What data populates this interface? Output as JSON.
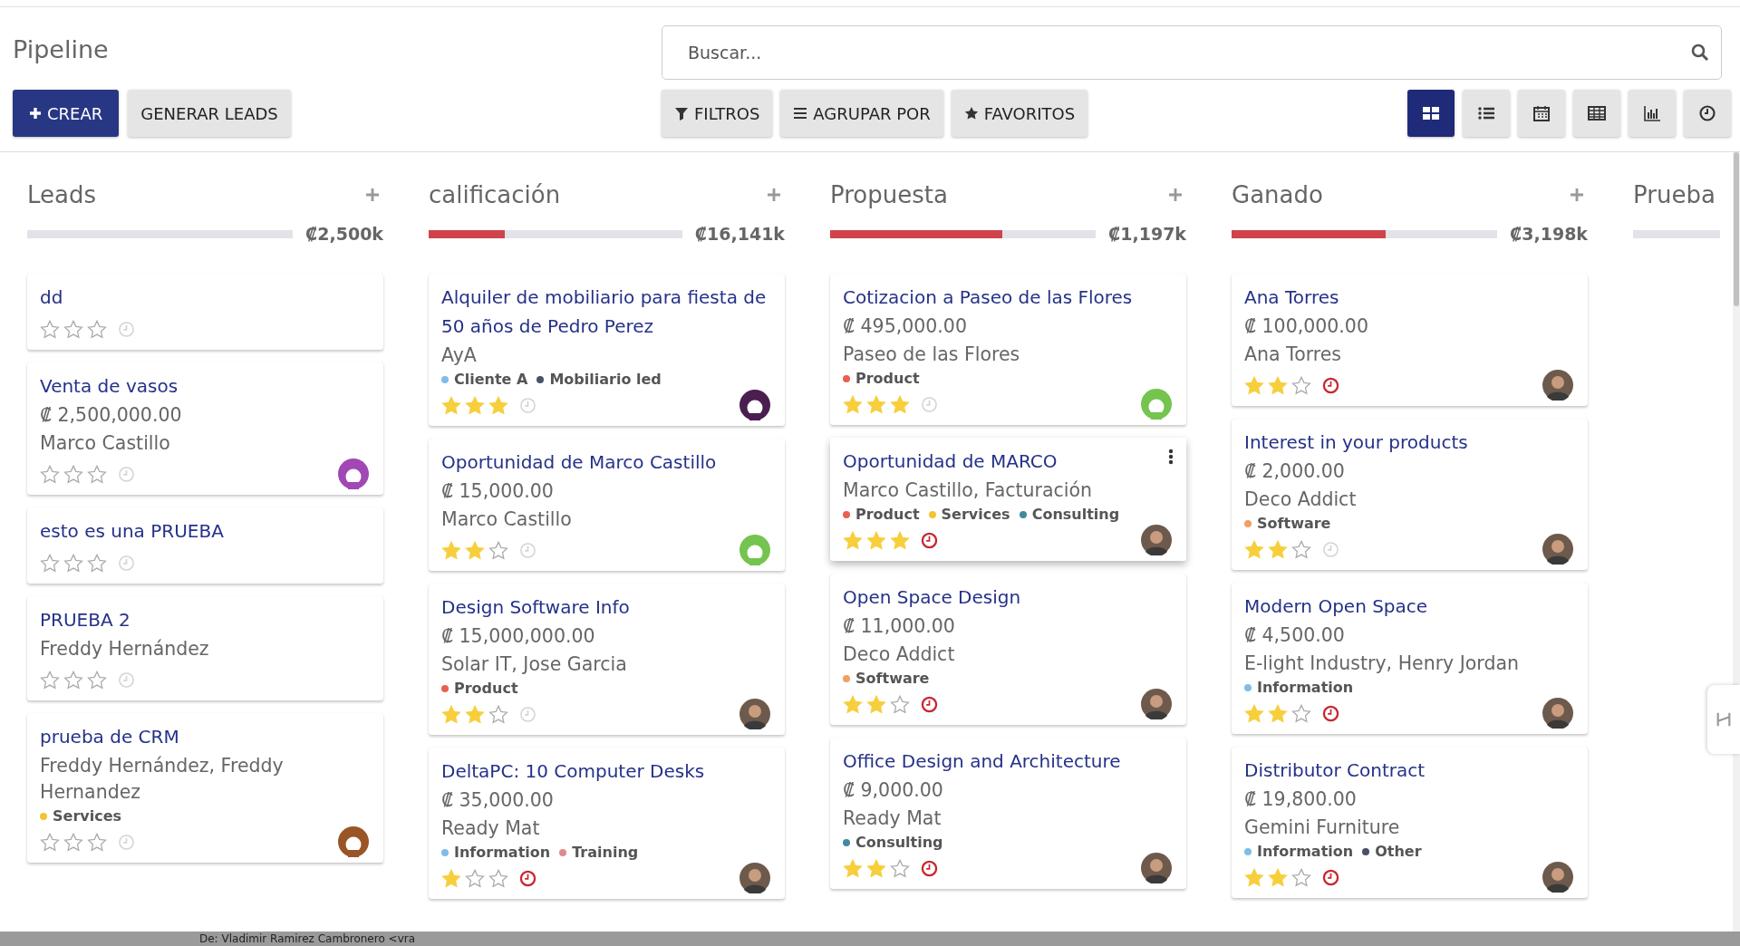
{
  "title": "Pipeline",
  "search": {
    "placeholder": "Buscar..."
  },
  "buttons": [
    {
      "label": "CREAR",
      "kind": "primary"
    },
    {
      "label": "GENERAR LEADS",
      "kind": "secondary"
    }
  ],
  "filters": [
    {
      "label": "FILTROS",
      "kind": "filter"
    },
    {
      "label": "AGRUPAR POR",
      "kind": "group"
    },
    {
      "label": "FAVORITOS",
      "kind": "star"
    }
  ],
  "views": [
    {
      "kind": "kanban",
      "selected": true
    },
    {
      "kind": "list",
      "selected": false
    },
    {
      "kind": "calendar",
      "selected": false
    },
    {
      "kind": "pivot",
      "selected": false
    },
    {
      "kind": "graph",
      "selected": false
    },
    {
      "kind": "activity",
      "selected": false
    }
  ],
  "columns": [
    {
      "name": "Leads",
      "total": "₡2,500k",
      "level": 0,
      "cards": [
        {
          "title": "dd",
          "stars": 0,
          "activity_overdue": false
        },
        {
          "title": "Venta de vasos",
          "amount": "₡ 2,500,000.00",
          "customer": "Marco Castillo",
          "stars": 0,
          "activity_overdue": false,
          "avatar": {
            "kind": "placeholder",
            "color": "#a148b4"
          }
        },
        {
          "title": "esto es una PRUEBA",
          "stars": 0,
          "activity_overdue": false
        },
        {
          "title": "PRUEBA 2",
          "customer": "Freddy Hernández",
          "stars": 0,
          "activity_overdue": false
        },
        {
          "title": "prueba de CRM",
          "customer": "Freddy Hernández, Freddy Hernandez",
          "tags": [
            {
              "name": "Services",
              "color": "#f4c430"
            }
          ],
          "stars": 0,
          "activity_overdue": false,
          "avatar": {
            "kind": "placeholder",
            "color": "#9a5526"
          }
        }
      ]
    },
    {
      "name": "calificación",
      "total": "₡16,141k",
      "level": 0.3,
      "cards": [
        {
          "title": "Alquiler de mobiliario para fiesta de 50 años de Pedro Perez",
          "customer": "AyA",
          "tags": [
            {
              "name": "Cliente A",
              "color": "#7fbde8"
            },
            {
              "name": "Mobiliario led",
              "color": "#4a5068"
            }
          ],
          "stars": 3,
          "activity_overdue": false,
          "avatar": {
            "kind": "placeholder",
            "color": "#4a1f4f"
          }
        },
        {
          "title": "Oportunidad de Marco Castillo",
          "amount": "₡ 15,000.00",
          "customer": "Marco Castillo",
          "stars": 2,
          "activity_overdue": false,
          "avatar": {
            "kind": "placeholder",
            "color": "#74c44f"
          }
        },
        {
          "title": "Design Software Info",
          "amount": "₡ 15,000,000.00",
          "customer": "Solar IT, Jose Garcia",
          "tags": [
            {
              "name": "Product",
              "color": "#e8604f"
            }
          ],
          "stars": 2,
          "activity_overdue": false,
          "avatar": {
            "kind": "photo"
          }
        },
        {
          "title": "DeltaPC: 10 Computer Desks",
          "amount": "₡ 35,000.00",
          "customer": "Ready Mat",
          "tags": [
            {
              "name": "Information",
              "color": "#7fbde8"
            },
            {
              "name": "Training",
              "color": "#e08a8a"
            }
          ],
          "stars": 1,
          "activity_overdue": true,
          "avatar": {
            "kind": "photo"
          }
        }
      ]
    },
    {
      "name": "Propuesta",
      "total": "₡1,197k",
      "level": 0.65,
      "cards": [
        {
          "title": "Cotizacion a Paseo de las Flores",
          "amount": "₡ 495,000.00",
          "customer": "Paseo de las Flores",
          "tags": [
            {
              "name": "Product",
              "color": "#e8604f"
            }
          ],
          "stars": 3,
          "activity_overdue": false,
          "avatar": {
            "kind": "placeholder",
            "color": "#74c44f"
          }
        },
        {
          "title": "Oportunidad de MARCO",
          "customer": "Marco Castillo, Facturación",
          "tags": [
            {
              "name": "Product",
              "color": "#e8604f"
            },
            {
              "name": "Services",
              "color": "#f4c430"
            },
            {
              "name": "Consulting",
              "color": "#3f8a9e"
            }
          ],
          "stars": 3,
          "activity_overdue": true,
          "avatar": {
            "kind": "photo"
          },
          "hovered": true
        },
        {
          "title": "Open Space Design",
          "amount": "₡ 11,000.00",
          "customer": "Deco Addict",
          "tags": [
            {
              "name": "Software",
              "color": "#f0a064"
            }
          ],
          "stars": 2,
          "activity_overdue": true,
          "avatar": {
            "kind": "photo"
          }
        },
        {
          "title": "Office Design and Architecture",
          "amount": "₡ 9,000.00",
          "customer": "Ready Mat",
          "tags": [
            {
              "name": "Consulting",
              "color": "#3f8a9e"
            }
          ],
          "stars": 2,
          "activity_overdue": true,
          "avatar": {
            "kind": "photo"
          }
        }
      ]
    },
    {
      "name": "Ganado",
      "total": "₡3,198k",
      "level": 0.58,
      "cards": [
        {
          "title": "Ana Torres",
          "amount": "₡ 100,000.00",
          "customer": "Ana Torres",
          "stars": 2,
          "activity_overdue": true,
          "avatar": {
            "kind": "photo"
          }
        },
        {
          "title": "Interest in your products",
          "amount": "₡ 2,000.00",
          "customer": "Deco Addict",
          "tags": [
            {
              "name": "Software",
              "color": "#f0a064"
            }
          ],
          "stars": 2,
          "activity_overdue": false,
          "avatar": {
            "kind": "photo"
          }
        },
        {
          "title": "Modern Open Space",
          "amount": "₡ 4,500.00",
          "customer": "E-light Industry, Henry Jordan",
          "tags": [
            {
              "name": "Information",
              "color": "#7fbde8"
            }
          ],
          "stars": 2,
          "activity_overdue": true,
          "avatar": {
            "kind": "photo"
          }
        },
        {
          "title": "Distributor Contract",
          "amount": "₡ 19,800.00",
          "customer": "Gemini Furniture",
          "tags": [
            {
              "name": "Information",
              "color": "#7fbde8"
            },
            {
              "name": "Other",
              "color": "#4a5068"
            }
          ],
          "stars": 2,
          "activity_overdue": true,
          "avatar": {
            "kind": "photo"
          }
        }
      ]
    },
    {
      "name": "Prueba",
      "level": 0
    }
  ],
  "footer_text": "De: Vladimir Ramirez Cambronero <vra"
}
